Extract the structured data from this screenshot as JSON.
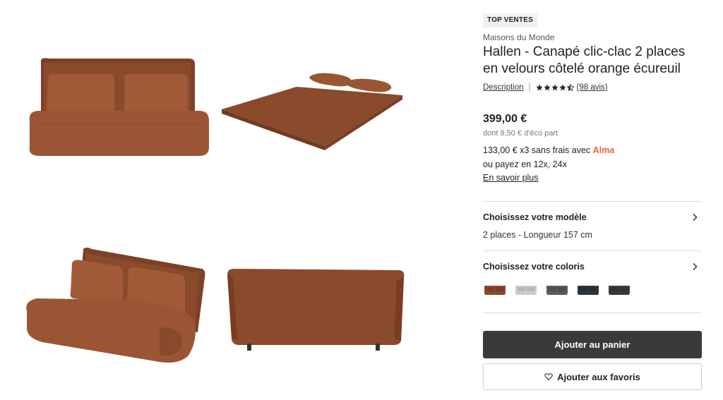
{
  "product": {
    "badge": "TOP VENTES",
    "brand": "Maisons du Monde",
    "title": "Hallen - Canapé clic-clac 2 places en velours côtelé orange écureuil",
    "description_link": "Description",
    "rating": 4.5,
    "reviews_label": "(98 avis)",
    "price": "399,00 €",
    "eco_part": "dont 8,50 € d'éco part",
    "installment_text": "133,00 € x3 sans frais avec ",
    "installment_brand": "Alma",
    "installment_other": "ou payez en 12x, 24x",
    "learn_more": "En savoir plus"
  },
  "options": {
    "model_title": "Choisissez votre modèle",
    "model_value": "2 places - Longueur 157 cm",
    "color_title": "Choisissez votre coloris",
    "swatch_colors": [
      "#8a4a2c",
      "#cfcac6",
      "#5a5a5a",
      "#2e3440",
      "#3b3b3d"
    ]
  },
  "actions": {
    "add_to_cart": "Ajouter au panier",
    "add_to_favorites": "Ajouter aux favoris"
  },
  "gallery": {
    "sofa_color": "#8a4a2c",
    "views": [
      "sofa-front-view",
      "sofa-bed-open-view",
      "sofa-angled-view",
      "sofa-back-view"
    ]
  }
}
